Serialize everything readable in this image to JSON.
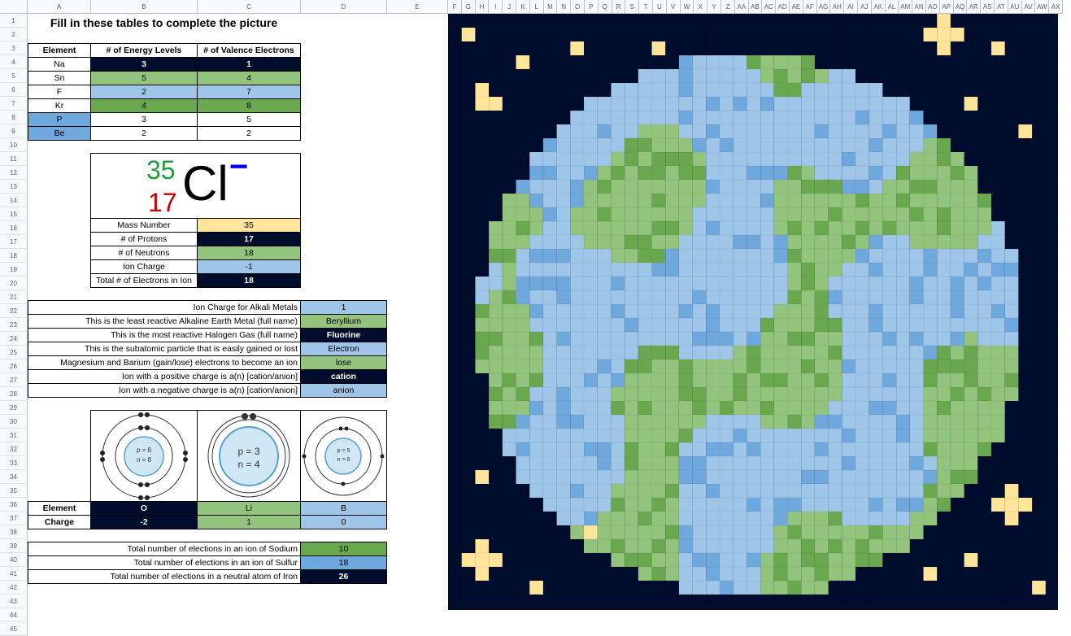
{
  "columns": [
    "A",
    "B",
    "C",
    "D",
    "E",
    "F",
    "G",
    "H",
    "I",
    "J",
    "K",
    "L",
    "M",
    "N",
    "O",
    "P",
    "Q",
    "R",
    "S",
    "T",
    "U",
    "V",
    "W",
    "X",
    "Y",
    "Z",
    "AA",
    "AB",
    "AC",
    "AD",
    "AE",
    "AF",
    "AG",
    "AH",
    "AI",
    "AJ",
    "AK",
    "AL",
    "AM",
    "AN",
    "AO",
    "AP",
    "AQ",
    "AR",
    "AS",
    "AT",
    "AU",
    "AV",
    "AW",
    "AX"
  ],
  "rows": [
    "1",
    "2",
    "3",
    "4",
    "5",
    "6",
    "7",
    "8",
    "9",
    "10",
    "11",
    "12",
    "13",
    "14",
    "15",
    "16",
    "17",
    "18",
    "19",
    "20",
    "21",
    "22",
    "23",
    "24",
    "25",
    "26",
    "27",
    "28",
    "29",
    "30",
    "31",
    "32",
    "33",
    "34",
    "35",
    "36",
    "37",
    "38",
    "39",
    "40",
    "41",
    "42",
    "43",
    "44",
    "45"
  ],
  "title": "Fill in these tables to complete the picture",
  "table1": {
    "headers": [
      "Element",
      "# of Energy Levels",
      "# of Valence Electrons"
    ],
    "rows": [
      {
        "element": "Na",
        "levels": "3",
        "valence": "1"
      },
      {
        "element": "Sn",
        "levels": "5",
        "valence": "4"
      },
      {
        "element": "F",
        "levels": "2",
        "valence": "7"
      },
      {
        "element": "Kr",
        "levels": "4",
        "valence": "8"
      },
      {
        "element": "P",
        "levels": "3",
        "valence": "5"
      },
      {
        "element": "Be",
        "levels": "2",
        "valence": "2"
      }
    ]
  },
  "isotope": {
    "mass": "35",
    "atomic": "17",
    "symbol": "Cl",
    "charge": "−"
  },
  "table2": {
    "rows": [
      {
        "label": "Mass Number",
        "value": "35"
      },
      {
        "label": "# of Protons",
        "value": "17"
      },
      {
        "label": "# of Neutrons",
        "value": "18"
      },
      {
        "label": "Ion Charge",
        "value": "-1"
      },
      {
        "label": "Total # of Electrons in Ion",
        "value": "18"
      }
    ]
  },
  "table3": {
    "rows": [
      {
        "question": "Ion Charge for Alkali Metals",
        "answer": "1"
      },
      {
        "question": "This is the least reactive Alkaline Earth Metal (full name)",
        "answer": "Beryllium"
      },
      {
        "question": "This is the most reactive Halogen Gas (full name)",
        "answer": "Fluorine"
      },
      {
        "question": "This is the subatomic particle that is easily gained or lost",
        "answer": "Electron"
      },
      {
        "question": "Magnesium and Barium (gain/lose) electrons to become an ion",
        "answer": "lose"
      },
      {
        "question": "Ion with a positive charge is a(n) [cation/anion]",
        "answer": "cation"
      },
      {
        "question": "Ion with a negative charge is a(n) [cation/anion]",
        "answer": "anion"
      }
    ]
  },
  "atoms": [
    {
      "p": "p = 8",
      "n": "n = 8"
    },
    {
      "p": "p = 3",
      "n": "n = 4"
    },
    {
      "p": "p = 5",
      "n": "n = 6"
    }
  ],
  "table4": {
    "element_label": "Element",
    "charge_label": "Charge",
    "elements": [
      "O",
      "Li",
      "B"
    ],
    "charges": [
      "-2",
      "1",
      "0"
    ]
  },
  "table5": {
    "rows": [
      {
        "question": "Total number of elections in an ion of Sodium",
        "answer": "10"
      },
      {
        "question": "Total number of elections in an ion of Sulfur",
        "answer": "18"
      },
      {
        "question": "Total number of elections in a neutral atom of Iron",
        "answer": "26"
      }
    ]
  },
  "colors": {
    "navy": "#000c2b",
    "light_green": "#93c47d",
    "dark_green": "#6aa84f",
    "light_blue": "#9fc5e8",
    "dark_blue": "#6fa8dc",
    "yellow": "#ffe599",
    "isotope_mass": "#1e9e3e",
    "isotope_atomic": "#c00000"
  }
}
